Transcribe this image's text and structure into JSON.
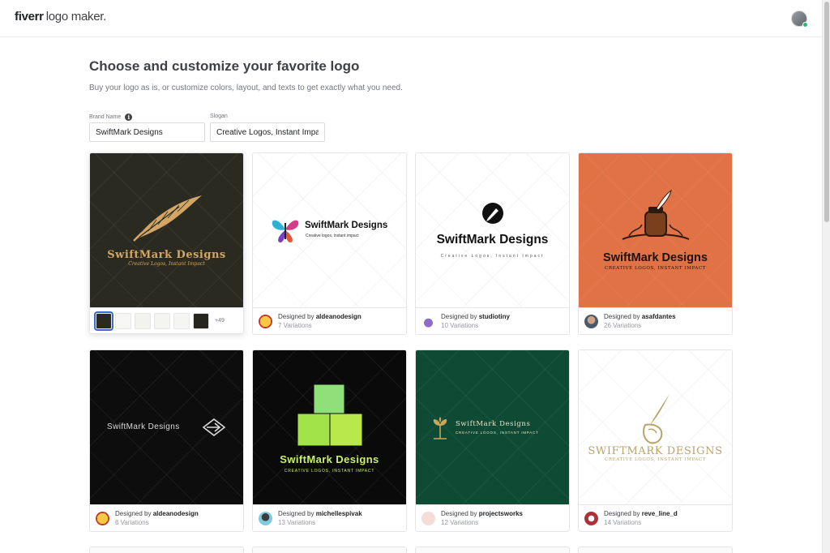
{
  "header": {
    "logo_brand": "fiverr",
    "logo_product": "logo maker."
  },
  "page": {
    "title": "Choose and customize your favorite logo",
    "subtitle": "Buy your logo as is, or customize colors, layout, and texts to get exactly what you need."
  },
  "form": {
    "brand_label": "Brand Name",
    "brand_value": "SwiftMark Designs",
    "slogan_label": "Slogan",
    "slogan_value": "Creative Logos, Instant Impact"
  },
  "colors": {
    "accent": "#1dbf73",
    "selection": "#3d6bd0"
  },
  "cards": [
    {
      "brand": "SwiftMark Designs",
      "slogan": "Creative Logos, Instant Impact",
      "bg": "#2a2a20",
      "icon": "quill-feather-icon",
      "swatches": [
        "#2a2a20",
        "#f7f7f5",
        "#f2f2ee",
        "#f4f4f0",
        "#f5f5f3",
        "#26261e"
      ],
      "more": "+49"
    },
    {
      "brand": "SwiftMark Designs",
      "slogan": "Creative logos, instant impact",
      "bg": "#ffffff",
      "icon": "butterfly-icon",
      "designer_prefix": "Designed by",
      "designer": "aldeanodesign",
      "variations": "7 Variations"
    },
    {
      "brand": "SwiftMark Designs",
      "slogan": "Creative Logos, Instant Impact",
      "bg": "#ffffff",
      "icon": "pen-nib-circle-icon",
      "designer_prefix": "Designed by",
      "designer": "studiotiny",
      "variations": "10 Variations"
    },
    {
      "brand": "SwiftMark Designs",
      "slogan": "CREATIVE LOGOS, INSTANT IMPACT",
      "bg": "#e07245",
      "icon": "inkwell-quill-icon",
      "designer_prefix": "Designed by",
      "designer": "asafdantes",
      "variations": "26 Variations"
    },
    {
      "brand": "SwiftMark Designs",
      "bg": "#0d0d0d",
      "icon": "diamond-arrow-icon",
      "designer_prefix": "Designed by",
      "designer": "aldeanodesign",
      "variations": "6 Variations"
    },
    {
      "brand": "SwiftMark Designs",
      "slogan": "CREATIVE LOGOS, INSTANT IMPACT",
      "bg": "#0a0a0a",
      "icon": "green-cubes-icon",
      "designer_prefix": "Designed by",
      "designer": "michellespivak",
      "variations": "13 Variations"
    },
    {
      "brand": "SwiftMark Designs",
      "slogan": "CREATIVE LOGOS, INSTANT IMPACT",
      "bg": "#0f4a34",
      "icon": "plant-sprout-icon",
      "designer_prefix": "Designed by",
      "designer": "projectsworks",
      "variations": "12 Variations"
    },
    {
      "brand": "SWIFTMARK DESIGNS",
      "slogan": "CREATIVE LOGOS, INSTANT IMPACT",
      "bg": "#ffffff",
      "icon": "quill-hand-icon",
      "designer_prefix": "Designed by",
      "designer": "reve_line_d",
      "variations": "14 Variations"
    }
  ]
}
